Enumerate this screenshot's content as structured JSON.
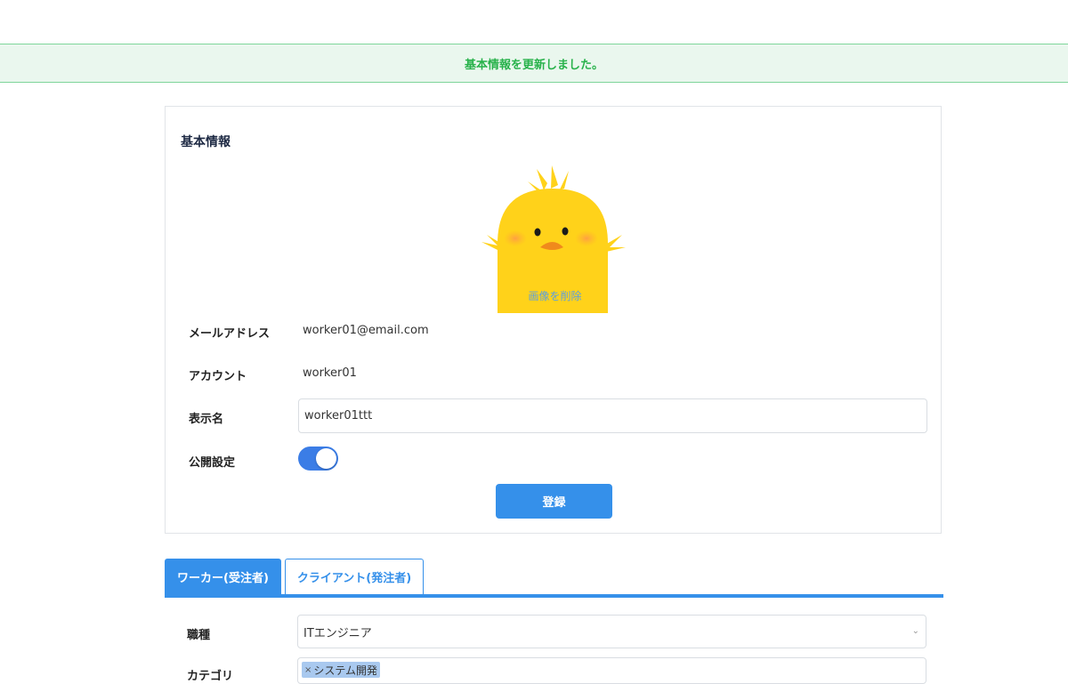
{
  "flash": {
    "message": "基本情報を更新しました。"
  },
  "basic_info": {
    "title": "基本情報",
    "avatar": {
      "delete_label": "画像を削除"
    },
    "email": {
      "label": "メールアドレス",
      "value": "worker01@email.com"
    },
    "account": {
      "label": "アカウント",
      "value": "worker01"
    },
    "display_name": {
      "label": "表示名",
      "value": "worker01ttt"
    },
    "public_setting": {
      "label": "公開設定",
      "enabled": true
    },
    "submit_label": "登録"
  },
  "tabs": [
    {
      "label": "ワーカー(受注者)",
      "active": true
    },
    {
      "label": "クライアント(発注者)",
      "active": false
    }
  ],
  "worker_profile": {
    "occupation": {
      "label": "職種",
      "value": "ITエンジニア"
    },
    "category": {
      "label": "カテゴリ",
      "chips": [
        {
          "remove": "×",
          "label": "システム開発"
        }
      ]
    }
  },
  "colors": {
    "accent": "#3590ea",
    "success_text": "#28b24b",
    "success_bg": "#eaf7ee",
    "toggle_on": "#3b7de6"
  },
  "icons": {
    "select_chevron": "chevron-down-icon"
  }
}
